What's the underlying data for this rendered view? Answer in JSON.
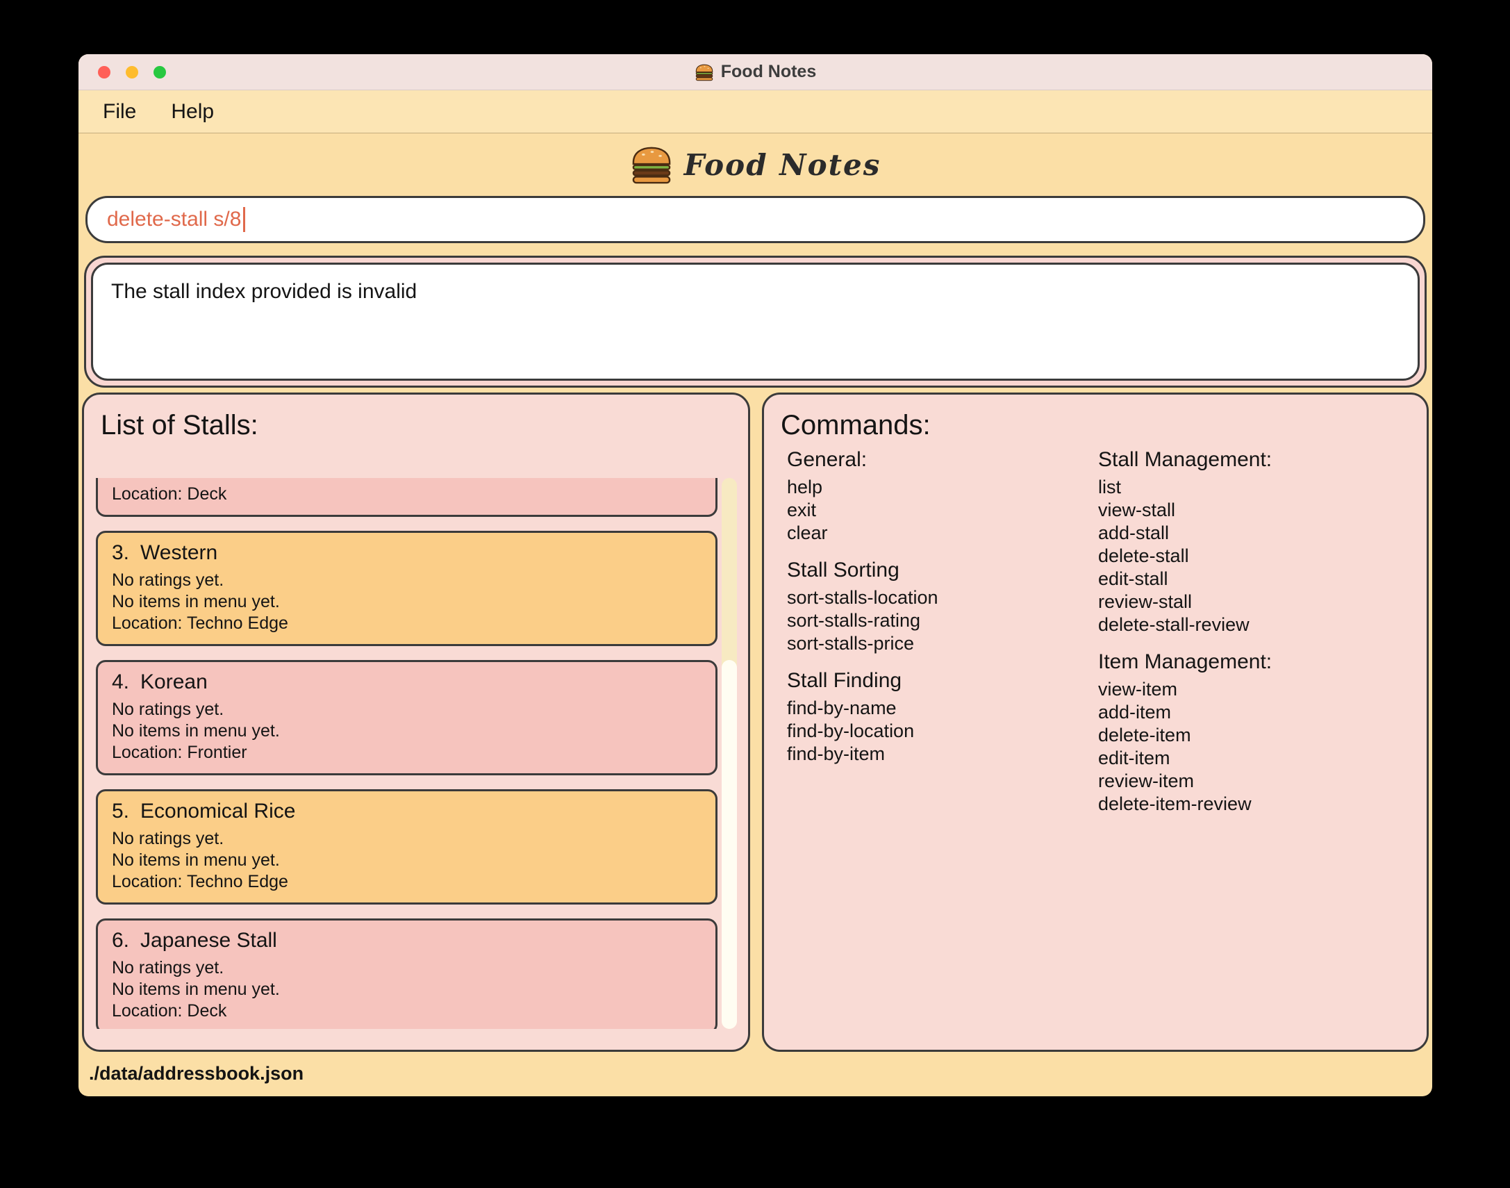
{
  "window": {
    "title": "Food Notes"
  },
  "menu": {
    "file": "File",
    "help": "Help"
  },
  "logo": {
    "text": "Food Notes"
  },
  "command_box": {
    "value": "delete-stall s/8"
  },
  "result_box": {
    "text": "The stall index provided is invalid"
  },
  "stall_list": {
    "title": "List of Stalls:",
    "partial_card": {
      "location": "Location: Deck"
    },
    "cards": [
      {
        "index": "3.",
        "name": "Western",
        "ratings": "No ratings yet.",
        "menu": "No items in menu yet.",
        "location": "Location: Techno Edge"
      },
      {
        "index": "4.",
        "name": "Korean",
        "ratings": "No ratings yet.",
        "menu": "No items in menu yet.",
        "location": "Location: Frontier"
      },
      {
        "index": "5.",
        "name": "Economical Rice",
        "ratings": "No ratings yet.",
        "menu": "No items in menu yet.",
        "location": "Location: Techno Edge"
      },
      {
        "index": "6.",
        "name": "Japanese Stall",
        "ratings": "No ratings yet.",
        "menu": "No items in menu yet.",
        "location": "Location: Deck"
      }
    ]
  },
  "commands": {
    "title": "Commands:",
    "col1": [
      {
        "header": "General:",
        "items": [
          "help",
          "exit",
          "clear"
        ]
      },
      {
        "header": "Stall Sorting",
        "items": [
          "sort-stalls-location",
          "sort-stalls-rating",
          "sort-stalls-price"
        ]
      },
      {
        "header": "Stall Finding",
        "items": [
          "find-by-name",
          "find-by-location",
          "find-by-item"
        ]
      }
    ],
    "col2": [
      {
        "header": "Stall Management:",
        "items": [
          "list",
          "view-stall",
          "add-stall",
          "delete-stall",
          "edit-stall",
          "review-stall",
          "delete-stall-review"
        ]
      },
      {
        "header": "Item Management:",
        "items": [
          "view-item",
          "add-item",
          "delete-item",
          "edit-item",
          "review-item",
          "delete-item-review"
        ]
      }
    ]
  },
  "status_bar": {
    "path": "./data/addressbook.json"
  },
  "colors": {
    "window_bg": "#fbdfa6",
    "titlebar_bg": "#f2e2df",
    "menubar_bg": "#fce5b4",
    "panel_pink": "#f9dbd5",
    "result_frame_pink": "#f8d6d1",
    "card_pink": "#f6c4be",
    "card_orange": "#fbce88",
    "border_dark": "#3b3b3b",
    "command_text": "#e0694b",
    "scroll_track": "#f7eac2",
    "scroll_thumb": "#fffdf2",
    "traffic_red": "#ff5f57",
    "traffic_yellow": "#febc2e",
    "traffic_green": "#28c840"
  }
}
